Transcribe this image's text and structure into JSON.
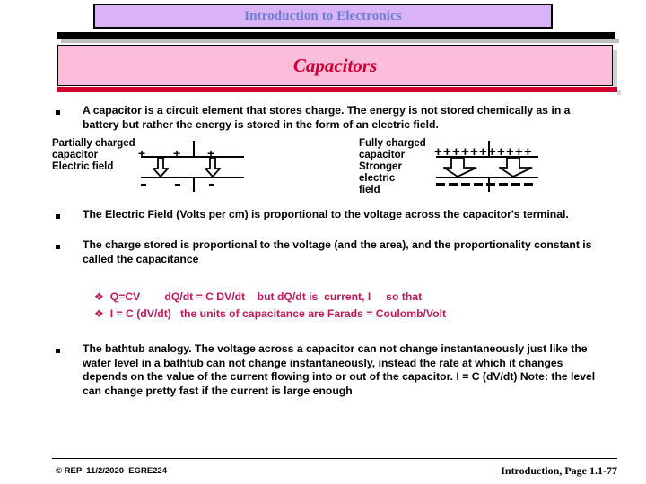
{
  "slide": {
    "header_title": "Introduction to Electronics",
    "subtitle": "Capacitors",
    "colors": {
      "header_box_bg": "#d9b3f5",
      "header_text": "#6b7fd7",
      "subtitle_box_bg": "#fbbdd9",
      "subtitle_text": "#cc0033",
      "red_rule": "#d6002e",
      "equation_text": "#c2185b",
      "body_text": "#000000"
    }
  },
  "bullets": [
    {
      "marker": "square-bullet",
      "text": "A capacitor is a circuit element that stores charge. The energy is not stored chemically as in a battery but rather the energy is stored in the form of an electric field."
    },
    {
      "marker": "square-bullet",
      "text": "The Electric Field (Volts per cm) is proportional to the voltage across the capacitor's terminal."
    },
    {
      "marker": "square-bullet",
      "text": "The charge stored is proportional to the voltage (and the area), and the proportionality constant is called the capacitance"
    },
    {
      "marker": "square-bullet",
      "text": "The bathtub analogy. The voltage across a capacitor can not change instantaneously just like the water level in a bathtub can not change instantaneously, instead the rate at which it changes depends on the value of the current flowing into or out of the capacitor.    I = C (dV/dt)  Note: the level can change pretty fast if the current is large enough"
    }
  ],
  "equations": [
    {
      "marker": "❖",
      "text": "Q=CV        dQ/dt = C DV/dt    but dQ/dt is  current, I     so that"
    },
    {
      "marker": "❖",
      "text": "I = C (dV/dt)   the units of capacitance are Farads = Coulomb/Volt"
    }
  ],
  "diagrams": [
    {
      "id": "partially-charged",
      "label": "Partially charged\ncapacitor\n Electric field",
      "plus_count": 3,
      "minus_count": 3,
      "arrow_count": 2,
      "arrow_style": "narrow"
    },
    {
      "id": "fully-charged",
      "label": "Fully charged\ncapacitor\n Stronger\n electric\n field",
      "plus_count": 11,
      "minus_count": 8,
      "arrow_count": 2,
      "arrow_style": "wide"
    }
  ],
  "footer": {
    "left": "© REP  11/2/2020  EGRE224",
    "right": "Introduction, Page 1.1-77"
  }
}
